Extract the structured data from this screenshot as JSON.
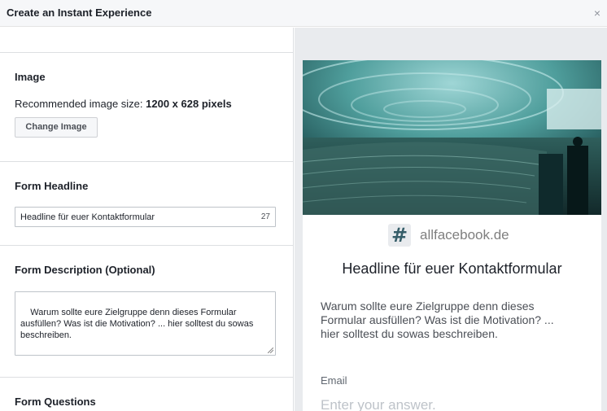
{
  "dialog": {
    "title": "Create an Instant Experience",
    "close_glyph": "×"
  },
  "editor": {
    "image_section": {
      "title": "Image",
      "recommend_prefix": "Recommended image size: ",
      "recommend_value": "1200 x 628 pixels",
      "change_button": "Change Image"
    },
    "headline_section": {
      "title": "Form Headline",
      "value": "Headline für euer Kontaktformular",
      "char_count": "27"
    },
    "description_section": {
      "title": "Form Description (Optional)",
      "value": "Warum sollte eure Zielgruppe denn dieses Formular ausfüllen? Was ist die Motivation? ... hier solltest du sowas beschreiben."
    },
    "questions_section": {
      "title": "Form Questions"
    }
  },
  "preview": {
    "brand_icon": "#",
    "brand_name": "allfacebook.de",
    "headline": "Headline für euer Kontaktformular",
    "description": "Warum sollte eure Zielgruppe denn dieses\nFormular ausfüllen? Was ist die Motivation? ...\nhier solltest du sowas beschreiben.",
    "email_label": "Email",
    "email_placeholder": "Enter your answer."
  },
  "colors": {
    "hero_tint": "#3b8a86",
    "hero_dark": "#0f2a2c",
    "logo_hash": "#365e69"
  }
}
